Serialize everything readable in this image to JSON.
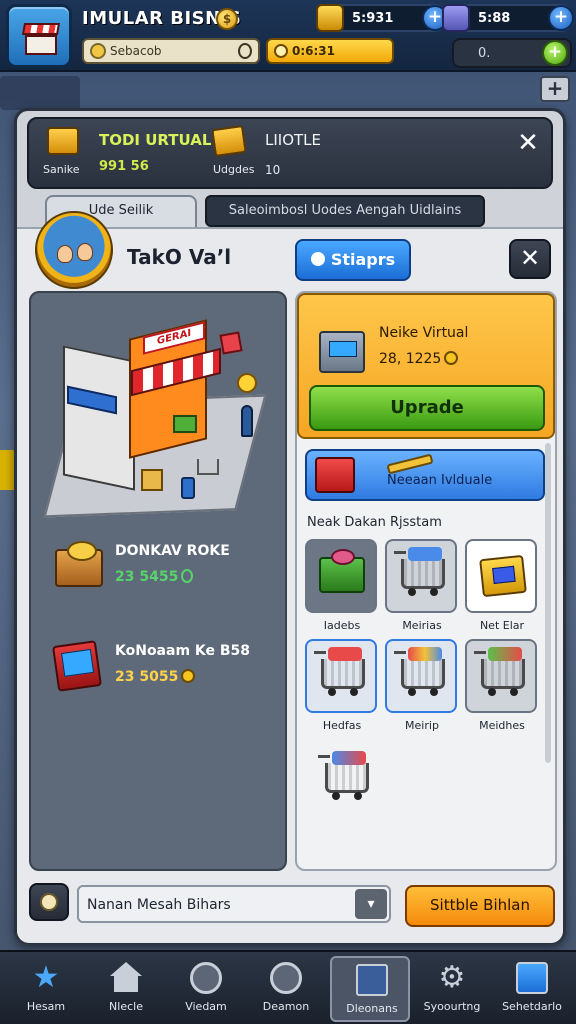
{
  "topbar": {
    "app_title": "IMULAR BISNIS",
    "title_coin": "$",
    "search_text": "Sebacob",
    "gold_pill_text": "0:6:31",
    "resource_1": "5:931",
    "resource_2": "5:88",
    "plus": "+",
    "settings_text": "0.",
    "mini_plus": "+"
  },
  "header": {
    "stat1_title": "TODI URTUAL",
    "stat1_sub": "Sanike",
    "stat1_value": "991 56",
    "stat2_title": "LIIOTLE",
    "stat2_sub": "Udgdes",
    "stat2_value": "10",
    "close": "✕"
  },
  "tabs": {
    "tab1": "Ude Seilik",
    "tab2": "Saleoimbosl Uodes Aengah Uidlains"
  },
  "shop": {
    "name": "TakO Vaʼl",
    "blue_button": "Stiaprs",
    "close": "✕",
    "store_sign": "GERAI"
  },
  "stats": [
    {
      "name": "DONKAV ROKE",
      "value": "23 5455",
      "icon": "chest-icon"
    },
    {
      "name": "KoNoaam Ke B58",
      "value": "23 5055",
      "icon": "tv-icon"
    }
  ],
  "upgrade": {
    "title": "Neike Virtual",
    "price": "28, 1225",
    "button": "Uprade"
  },
  "promo": {
    "text": "Neeaan Ivlduale"
  },
  "items_label": "Neak Dakan Rjsstam",
  "items": [
    {
      "label": "Iadebs",
      "type": "bin"
    },
    {
      "label": "Meirias",
      "type": "cart-blue"
    },
    {
      "label": "Net Elar",
      "type": "gold-box"
    },
    {
      "label": "Hedfas",
      "type": "cart-red"
    },
    {
      "label": "Meirip",
      "type": "cart-multi"
    },
    {
      "label": "Meidhes",
      "type": "cart-green"
    }
  ],
  "footer": {
    "select_text": "Nanan Mesah Bihars",
    "select_arrow": "▾",
    "orange_button": "Sittble Bihlan"
  },
  "bottom_nav": [
    {
      "label": "Hesam",
      "icon": "star-icon"
    },
    {
      "label": "Nlecle",
      "icon": "home-icon"
    },
    {
      "label": "Viedam",
      "icon": "globe-icon"
    },
    {
      "label": "Deamon",
      "icon": "search-icon"
    },
    {
      "label": "Dleonans",
      "icon": "document-icon"
    },
    {
      "label": "Syoourtng",
      "icon": "gear-icon"
    },
    {
      "label": "Sehetdarlo",
      "icon": "box-icon"
    }
  ]
}
